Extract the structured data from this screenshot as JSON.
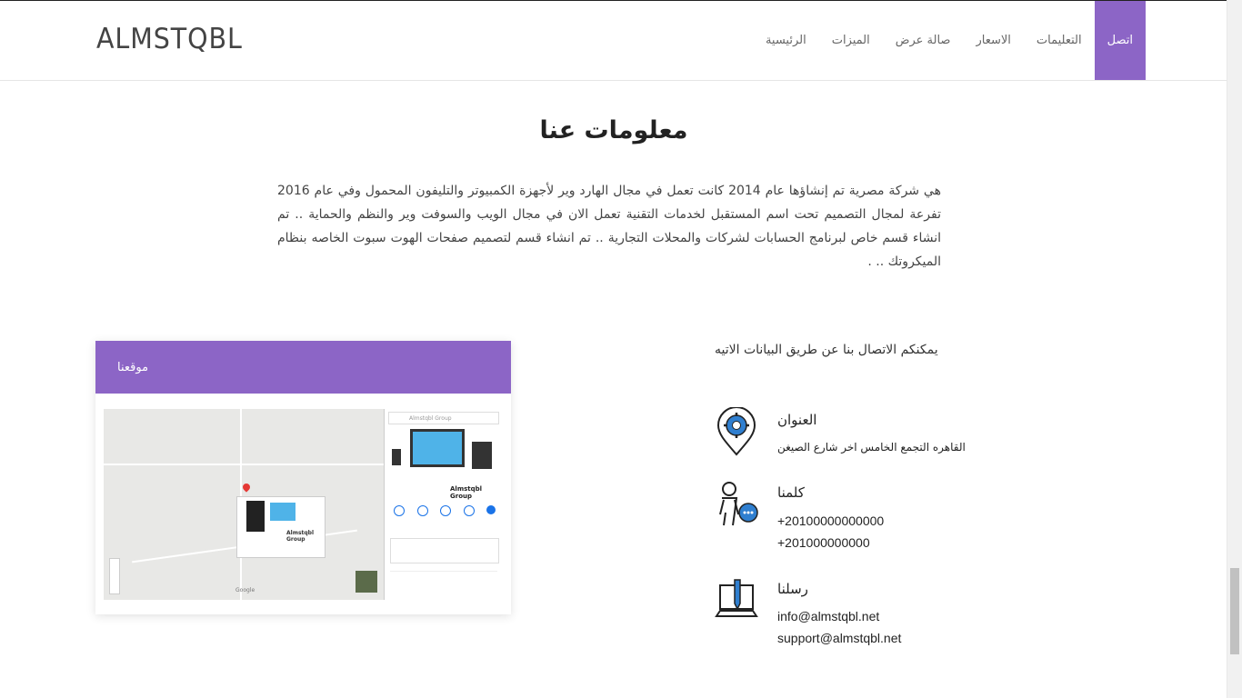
{
  "header": {
    "logo": "ALMSTQBL",
    "nav": [
      {
        "label": "اتصل",
        "active": true
      },
      {
        "label": "التعليمات",
        "active": false
      },
      {
        "label": "الاسعار",
        "active": false
      },
      {
        "label": "صالة عرض",
        "active": false
      },
      {
        "label": "الميزات",
        "active": false
      },
      {
        "label": "الرئيسية",
        "active": false
      }
    ]
  },
  "about": {
    "title": "معلومات عنا",
    "text": "هي شركة مصرية تم إنشاؤها عام 2014 كانت تعمل في مجال الهارد وير لأجهزة الكمبيوتر والتليفون المحمول وفي عام 2016 تفرعة لمجال التصميم تحت اسم المستقبل لخدمات التقنية تعمل الان في مجال الويب والسوفت وير والنظم والحماية .. تم انشاء قسم خاص لبرنامج الحسابات لشركات والمحلات التجارية .. تم انشاء قسم لتصميم صفحات الهوت سبوت الخاصه بنظام الميكروتك .. ."
  },
  "map": {
    "card_title": "موقعنا",
    "search_placeholder": "Almstqbl Group",
    "place_name": "Almstqbl Group",
    "google_label": "Google"
  },
  "contact": {
    "intro": "يمكنكم الاتصال بنا عن طريق البيانات الاتيه",
    "address": {
      "label": "العنوان",
      "value": "القاهره التجمع الخامس اخر شارع الصيغن",
      "icon": "map-pin-gear-icon"
    },
    "phones": {
      "label": "كلمنا",
      "values": [
        "+20100000000000",
        "+201000000000"
      ],
      "icon": "person-chat-icon"
    },
    "emails": {
      "label": "رسلنا",
      "values": [
        "info@almstqbl.net",
        "support@almstqbl.net"
      ],
      "icon": "laptop-pen-icon"
    }
  },
  "colors": {
    "accent": "#8c65c6",
    "icon_blue": "#2f7fd0"
  }
}
